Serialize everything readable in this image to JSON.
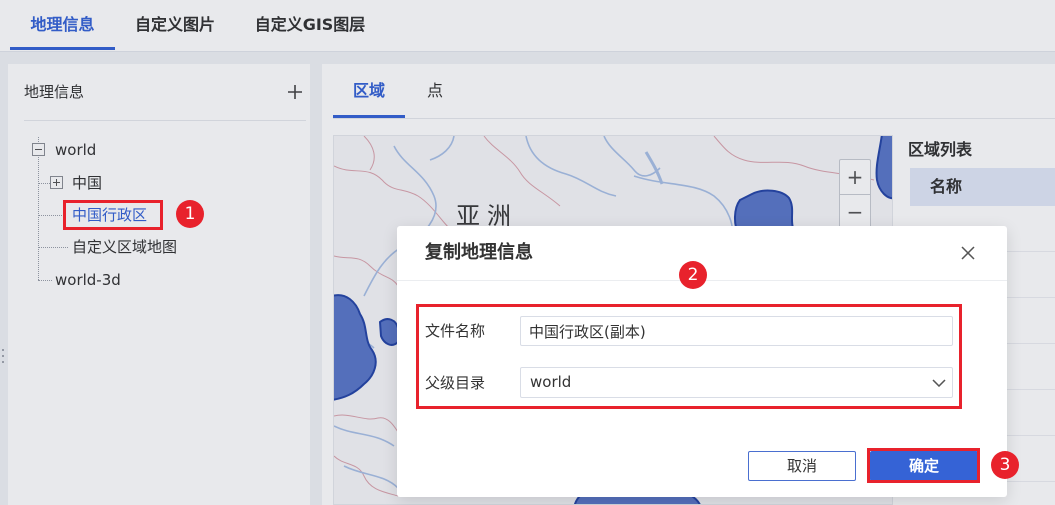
{
  "top_tabs": [
    {
      "label": "地理信息",
      "active": true
    },
    {
      "label": "自定义图片",
      "active": false
    },
    {
      "label": "自定义GIS图层",
      "active": false
    }
  ],
  "sidebar": {
    "title": "地理信息",
    "add_icon": "plus-icon",
    "tree": [
      {
        "label": "world",
        "icon": "collapse-box-icon"
      },
      {
        "label": "中国",
        "icon": "expand-box-icon"
      },
      {
        "label": "中国行政区",
        "selected": true
      },
      {
        "label": "自定义区域地图"
      },
      {
        "label": "world-3d"
      }
    ]
  },
  "main": {
    "tabs": [
      {
        "label": "区域",
        "active": true
      },
      {
        "label": "点",
        "active": false
      }
    ],
    "map": {
      "continent_label": "亚洲",
      "zoom_in": "+",
      "zoom_out": "−"
    },
    "region_list": {
      "title": "区域列表",
      "column_header": "名称"
    }
  },
  "dialog": {
    "title": "复制地理信息",
    "close_icon": "close-icon",
    "file_name_label": "文件名称",
    "file_name_value": "中国行政区(副本)",
    "parent_dir_label": "父级目录",
    "parent_dir_value": "world",
    "dropdown_icon": "chevron-down-icon",
    "cancel_label": "取消",
    "confirm_label": "确定"
  },
  "annotations": [
    "1",
    "2",
    "3"
  ],
  "colors": {
    "accent": "#3563d6",
    "annotation_red": "#e8222c",
    "region_highlight": "#5b78c9"
  }
}
